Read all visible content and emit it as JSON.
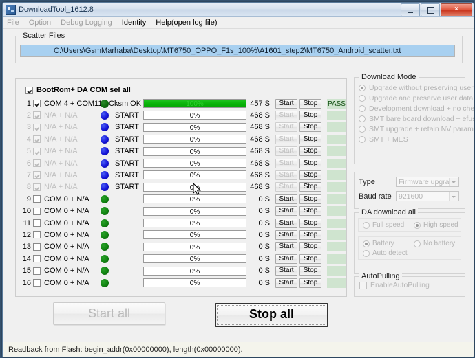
{
  "window": {
    "title": "DownloadTool_1612.8",
    "icon": "app-icon",
    "minimize_label": "",
    "maximize_label": "",
    "close_label": "×"
  },
  "menu": {
    "items": [
      {
        "label": "File",
        "enabled": false
      },
      {
        "label": "Option",
        "enabled": false
      },
      {
        "label": "Debug Logging",
        "enabled": false
      },
      {
        "label": "Identity",
        "enabled": true
      },
      {
        "label": "Help(open log file)",
        "enabled": true
      }
    ]
  },
  "scatter": {
    "group_title": "Scatter Files",
    "path": "C:\\Users\\GsmMarhaba\\Desktop\\MT6750_OPPO_F1s_100%\\A1601_step2\\MT6750_Android_scatter.txt"
  },
  "com_panel": {
    "select_all_label": "BootRom+ DA COM sel all",
    "select_all_checked": true,
    "start_button_label": "Start",
    "stop_button_label": "Stop",
    "rows": [
      {
        "num": "1",
        "com": "COM 4 + COM11",
        "checked": true,
        "dimmed": false,
        "dot": "darkgreen",
        "status": "Cksm OK",
        "percent": "100%",
        "progress": 100,
        "time": "457 S",
        "start_enabled": true,
        "stop_enabled": true,
        "badge": "PASS"
      },
      {
        "num": "2",
        "com": "N/A + N/A",
        "checked": true,
        "dimmed": true,
        "dot": "blue",
        "status": "START",
        "percent": "0%",
        "progress": 0,
        "time": "468 S",
        "start_enabled": false,
        "stop_enabled": true,
        "badge": ""
      },
      {
        "num": "3",
        "com": "N/A + N/A",
        "checked": true,
        "dimmed": true,
        "dot": "blue",
        "status": "START",
        "percent": "0%",
        "progress": 0,
        "time": "468 S",
        "start_enabled": false,
        "stop_enabled": true,
        "badge": ""
      },
      {
        "num": "4",
        "com": "N/A + N/A",
        "checked": true,
        "dimmed": true,
        "dot": "blue",
        "status": "START",
        "percent": "0%",
        "progress": 0,
        "time": "468 S",
        "start_enabled": false,
        "stop_enabled": true,
        "badge": ""
      },
      {
        "num": "5",
        "com": "N/A + N/A",
        "checked": true,
        "dimmed": true,
        "dot": "blue",
        "status": "START",
        "percent": "0%",
        "progress": 0,
        "time": "468 S",
        "start_enabled": false,
        "stop_enabled": true,
        "badge": ""
      },
      {
        "num": "6",
        "com": "N/A + N/A",
        "checked": true,
        "dimmed": true,
        "dot": "blue",
        "status": "START",
        "percent": "0%",
        "progress": 0,
        "time": "468 S",
        "start_enabled": false,
        "stop_enabled": true,
        "badge": ""
      },
      {
        "num": "7",
        "com": "N/A + N/A",
        "checked": true,
        "dimmed": true,
        "dot": "blue",
        "status": "START",
        "percent": "0%",
        "progress": 0,
        "time": "468 S",
        "start_enabled": false,
        "stop_enabled": true,
        "badge": ""
      },
      {
        "num": "8",
        "com": "N/A + N/A",
        "checked": true,
        "dimmed": true,
        "dot": "blue",
        "status": "START",
        "percent": "0%",
        "progress": 0,
        "time": "468 S",
        "start_enabled": false,
        "stop_enabled": true,
        "badge": ""
      },
      {
        "num": "9",
        "com": "COM 0 + N/A",
        "checked": false,
        "dimmed": false,
        "dot": "green",
        "status": "",
        "percent": "0%",
        "progress": 0,
        "time": "0 S",
        "start_enabled": true,
        "stop_enabled": true,
        "badge": ""
      },
      {
        "num": "10",
        "com": "COM 0 + N/A",
        "checked": false,
        "dimmed": false,
        "dot": "green",
        "status": "",
        "percent": "0%",
        "progress": 0,
        "time": "0 S",
        "start_enabled": true,
        "stop_enabled": true,
        "badge": ""
      },
      {
        "num": "11",
        "com": "COM 0 + N/A",
        "checked": false,
        "dimmed": false,
        "dot": "green",
        "status": "",
        "percent": "0%",
        "progress": 0,
        "time": "0 S",
        "start_enabled": true,
        "stop_enabled": true,
        "badge": ""
      },
      {
        "num": "12",
        "com": "COM 0 + N/A",
        "checked": false,
        "dimmed": false,
        "dot": "green",
        "status": "",
        "percent": "0%",
        "progress": 0,
        "time": "0 S",
        "start_enabled": true,
        "stop_enabled": true,
        "badge": ""
      },
      {
        "num": "13",
        "com": "COM 0 + N/A",
        "checked": false,
        "dimmed": false,
        "dot": "green",
        "status": "",
        "percent": "0%",
        "progress": 0,
        "time": "0 S",
        "start_enabled": true,
        "stop_enabled": true,
        "badge": ""
      },
      {
        "num": "14",
        "com": "COM 0 + N/A",
        "checked": false,
        "dimmed": false,
        "dot": "green",
        "status": "",
        "percent": "0%",
        "progress": 0,
        "time": "0 S",
        "start_enabled": true,
        "stop_enabled": true,
        "badge": ""
      },
      {
        "num": "15",
        "com": "COM 0 + N/A",
        "checked": false,
        "dimmed": false,
        "dot": "green",
        "status": "",
        "percent": "0%",
        "progress": 0,
        "time": "0 S",
        "start_enabled": true,
        "stop_enabled": true,
        "badge": ""
      },
      {
        "num": "16",
        "com": "COM 0 + N/A",
        "checked": false,
        "dimmed": false,
        "dot": "green",
        "status": "",
        "percent": "0%",
        "progress": 0,
        "time": "0 S",
        "start_enabled": true,
        "stop_enabled": true,
        "badge": ""
      }
    ]
  },
  "download_mode": {
    "group_title": "Download Mode",
    "options": [
      {
        "label": "Upgrade without preserving user data",
        "selected": true
      },
      {
        "label": "Upgrade and preserve user data",
        "selected": false
      },
      {
        "label": "Development download + no checksum",
        "selected": false
      },
      {
        "label": "SMT bare board download + efuse",
        "selected": false
      },
      {
        "label": "SMT upgrade + retain NV parameters",
        "selected": false
      },
      {
        "label": "SMT + MES",
        "selected": false
      }
    ]
  },
  "type_section": {
    "type_label": "Type",
    "type_value": "Firmware upgrade",
    "baud_label": "Baud rate",
    "baud_value": "921600"
  },
  "da_download": {
    "group_title": "DA download all",
    "speed": [
      {
        "label": "Full speed",
        "selected": false
      },
      {
        "label": "High speed",
        "selected": true
      }
    ],
    "battery": [
      {
        "label": "Battery",
        "selected": true
      },
      {
        "label": "No battery",
        "selected": false
      },
      {
        "label": "Auto detect",
        "selected": false
      }
    ]
  },
  "autopulling": {
    "group_title": "AutoPulling",
    "checkbox_label": "EnableAutoPulling",
    "checked": false
  },
  "actions": {
    "start_all_label": "Start all",
    "start_all_enabled": false,
    "stop_all_label": "Stop all",
    "stop_all_enabled": true
  },
  "statusbar": {
    "text": "Readback from Flash:  begin_addr(0x00000000), length(0x00000000)."
  },
  "colors": {
    "progress_green": "#0bb50b",
    "dot_blue": "#1414d8",
    "dot_green": "#118511",
    "selection_blue": "#a8d0f0",
    "close_red": "#c8331c"
  }
}
